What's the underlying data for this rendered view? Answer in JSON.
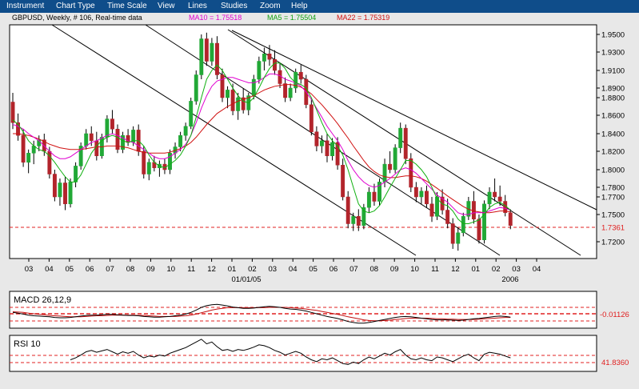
{
  "menu": {
    "items": [
      "Instrument",
      "Chart Type",
      "Time Scale",
      "View",
      "Lines",
      "Studies",
      "Zoom",
      "Help"
    ]
  },
  "colors": {
    "menu_bg": "#0f4d8a",
    "panel_bg": "#ffffff",
    "frame_bg": "#e8e8e8",
    "up_candle": "#21a836",
    "down_candle": "#b2242b",
    "ma10": "#e000d0",
    "ma5": "#10b010",
    "ma22": "#d01010",
    "ref_line": "#e02020"
  },
  "header": {
    "symbol": "GBPUSD",
    "period": "Weekly",
    "count": "# 106",
    "feed": "Real-time data",
    "ma10_label": "MA10 = 1.75518",
    "ma5_label": "MA5 = 1.75504",
    "ma22_label": "MA22 = 1.75319"
  },
  "chart_data": [
    {
      "type": "candlestick",
      "price_levels": [
        1.95,
        1.93,
        1.91,
        1.89,
        1.88,
        1.86,
        1.84,
        1.82,
        1.8,
        1.78,
        1.77,
        1.75,
        1.72
      ],
      "last_price_label": "1.7361",
      "last_price": 1.7361,
      "x_ticks": [
        "03",
        "04",
        "05",
        "06",
        "07",
        "08",
        "09",
        "10",
        "11",
        "12",
        "01",
        "02",
        "03",
        "04",
        "05",
        "06",
        "07",
        "08",
        "09",
        "10",
        "11",
        "12",
        "01",
        "02",
        "03",
        "04"
      ],
      "x_sublabels": [
        "01/01/05",
        "2006"
      ],
      "candles": [
        [
          1.875,
          1.885,
          1.845,
          1.852
        ],
        [
          1.852,
          1.862,
          1.832,
          1.838
        ],
        [
          1.838,
          1.845,
          1.803,
          1.808
        ],
        [
          1.808,
          1.822,
          1.796,
          1.818
        ],
        [
          1.818,
          1.832,
          1.806,
          1.826
        ],
        [
          1.826,
          1.838,
          1.82,
          1.833
        ],
        [
          1.833,
          1.84,
          1.815,
          1.82
        ],
        [
          1.82,
          1.825,
          1.79,
          1.795
        ],
        [
          1.795,
          1.8,
          1.765,
          1.77
        ],
        [
          1.77,
          1.79,
          1.76,
          1.785
        ],
        [
          1.785,
          1.792,
          1.755,
          1.762
        ],
        [
          1.762,
          1.79,
          1.758,
          1.786
        ],
        [
          1.786,
          1.808,
          1.78,
          1.804
        ],
        [
          1.804,
          1.83,
          1.8,
          1.826
        ],
        [
          1.826,
          1.845,
          1.822,
          1.84
        ],
        [
          1.84,
          1.848,
          1.826,
          1.832
        ],
        [
          1.832,
          1.842,
          1.81,
          1.815
        ],
        [
          1.815,
          1.84,
          1.812,
          1.836
        ],
        [
          1.836,
          1.86,
          1.83,
          1.856
        ],
        [
          1.856,
          1.866,
          1.84,
          1.845
        ],
        [
          1.845,
          1.85,
          1.818,
          1.822
        ],
        [
          1.822,
          1.842,
          1.818,
          1.838
        ],
        [
          1.838,
          1.845,
          1.826,
          1.83
        ],
        [
          1.83,
          1.848,
          1.826,
          1.844
        ],
        [
          1.844,
          1.85,
          1.815,
          1.82
        ],
        [
          1.82,
          1.826,
          1.79,
          1.795
        ],
        [
          1.795,
          1.812,
          1.788,
          1.808
        ],
        [
          1.808,
          1.815,
          1.798,
          1.802
        ],
        [
          1.802,
          1.81,
          1.792,
          1.806
        ],
        [
          1.806,
          1.812,
          1.795,
          1.8
        ],
        [
          1.8,
          1.822,
          1.795,
          1.818
        ],
        [
          1.818,
          1.83,
          1.812,
          1.825
        ],
        [
          1.825,
          1.842,
          1.82,
          1.838
        ],
        [
          1.838,
          1.852,
          1.832,
          1.848
        ],
        [
          1.848,
          1.88,
          1.845,
          1.876
        ],
        [
          1.876,
          1.91,
          1.872,
          1.905
        ],
        [
          1.905,
          1.95,
          1.9,
          1.945
        ],
        [
          1.945,
          1.952,
          1.915,
          1.92
        ],
        [
          1.92,
          1.946,
          1.915,
          1.94
        ],
        [
          1.94,
          1.948,
          1.9,
          1.905
        ],
        [
          1.905,
          1.912,
          1.875,
          1.88
        ],
        [
          1.88,
          1.892,
          1.868,
          1.888
        ],
        [
          1.888,
          1.895,
          1.86,
          1.865
        ],
        [
          1.865,
          1.885,
          1.855,
          1.88
        ],
        [
          1.88,
          1.89,
          1.862,
          1.866
        ],
        [
          1.866,
          1.885,
          1.86,
          1.882
        ],
        [
          1.882,
          1.905,
          1.878,
          1.9
        ],
        [
          1.9,
          1.925,
          1.895,
          1.92
        ],
        [
          1.92,
          1.935,
          1.91,
          1.928
        ],
        [
          1.928,
          1.938,
          1.915,
          1.922
        ],
        [
          1.922,
          1.932,
          1.905,
          1.91
        ],
        [
          1.91,
          1.918,
          1.89,
          1.895
        ],
        [
          1.895,
          1.902,
          1.875,
          1.88
        ],
        [
          1.88,
          1.895,
          1.876,
          1.89
        ],
        [
          1.89,
          1.912,
          1.885,
          1.908
        ],
        [
          1.908,
          1.916,
          1.895,
          1.9
        ],
        [
          1.9,
          1.905,
          1.868,
          1.872
        ],
        [
          1.872,
          1.878,
          1.838,
          1.842
        ],
        [
          1.842,
          1.848,
          1.82,
          1.826
        ],
        [
          1.826,
          1.838,
          1.818,
          1.832
        ],
        [
          1.832,
          1.84,
          1.808,
          1.815
        ],
        [
          1.815,
          1.835,
          1.81,
          1.83
        ],
        [
          1.83,
          1.836,
          1.8,
          1.805
        ],
        [
          1.805,
          1.812,
          1.766,
          1.77
        ],
        [
          1.77,
          1.776,
          1.735,
          1.74
        ],
        [
          1.74,
          1.752,
          1.732,
          1.748
        ],
        [
          1.748,
          1.756,
          1.732,
          1.738
        ],
        [
          1.738,
          1.762,
          1.734,
          1.758
        ],
        [
          1.758,
          1.78,
          1.752,
          1.775
        ],
        [
          1.775,
          1.784,
          1.76,
          1.765
        ],
        [
          1.765,
          1.79,
          1.76,
          1.786
        ],
        [
          1.786,
          1.812,
          1.78,
          1.806
        ],
        [
          1.806,
          1.82,
          1.796,
          1.8
        ],
        [
          1.8,
          1.828,
          1.796,
          1.824
        ],
        [
          1.824,
          1.852,
          1.818,
          1.846
        ],
        [
          1.846,
          1.85,
          1.806,
          1.812
        ],
        [
          1.812,
          1.818,
          1.775,
          1.78
        ],
        [
          1.78,
          1.786,
          1.764,
          1.77
        ],
        [
          1.77,
          1.78,
          1.762,
          1.776
        ],
        [
          1.776,
          1.782,
          1.758,
          1.762
        ],
        [
          1.762,
          1.77,
          1.742,
          1.748
        ],
        [
          1.748,
          1.775,
          1.744,
          1.77
        ],
        [
          1.77,
          1.778,
          1.75,
          1.755
        ],
        [
          1.755,
          1.768,
          1.735,
          1.74
        ],
        [
          1.74,
          1.746,
          1.712,
          1.718
        ],
        [
          1.718,
          1.736,
          1.71,
          1.73
        ],
        [
          1.73,
          1.752,
          1.726,
          1.748
        ],
        [
          1.748,
          1.77,
          1.744,
          1.765
        ],
        [
          1.765,
          1.776,
          1.74,
          1.745
        ],
        [
          1.745,
          1.75,
          1.718,
          1.722
        ],
        [
          1.722,
          1.766,
          1.718,
          1.762
        ],
        [
          1.762,
          1.78,
          1.756,
          1.775
        ],
        [
          1.775,
          1.79,
          1.765,
          1.77
        ],
        [
          1.77,
          1.782,
          1.76,
          1.765
        ],
        [
          1.765,
          1.772,
          1.748,
          1.752
        ],
        [
          1.752,
          1.756,
          1.734,
          1.738
        ]
      ],
      "ma10": [
        1.85,
        1.848,
        1.845,
        1.84,
        1.836,
        1.832,
        1.826,
        1.82,
        1.815,
        1.812,
        1.812,
        1.814,
        1.818,
        1.822,
        1.826,
        1.83,
        1.832,
        1.835,
        1.838,
        1.84,
        1.838,
        1.835,
        1.832,
        1.83,
        1.826,
        1.822,
        1.818,
        1.814,
        1.812,
        1.812,
        1.814,
        1.818,
        1.822,
        1.828,
        1.838,
        1.852,
        1.868,
        1.882,
        1.892,
        1.898,
        1.9,
        1.902,
        1.902,
        1.9,
        1.898,
        1.896,
        1.896,
        1.898,
        1.902,
        1.906,
        1.906,
        1.904,
        1.9,
        1.898,
        1.896,
        1.892,
        1.886,
        1.878,
        1.868,
        1.858,
        1.848,
        1.84,
        1.832,
        1.822,
        1.81,
        1.8,
        1.792,
        1.786,
        1.782,
        1.78,
        1.782,
        1.786,
        1.79,
        1.795,
        1.8,
        1.802,
        1.8,
        1.796,
        1.79,
        1.784,
        1.778,
        1.772,
        1.768,
        1.764,
        1.758,
        1.752,
        1.75,
        1.75,
        1.752,
        1.752,
        1.752,
        1.754,
        1.756,
        1.758,
        1.757,
        1.755
      ],
      "ma5": [
        1.855,
        1.85,
        1.842,
        1.832,
        1.826,
        1.822,
        1.82,
        1.815,
        1.808,
        1.8,
        1.792,
        1.786,
        1.786,
        1.794,
        1.806,
        1.818,
        1.826,
        1.832,
        1.836,
        1.838,
        1.836,
        1.832,
        1.83,
        1.832,
        1.832,
        1.826,
        1.816,
        1.808,
        1.804,
        1.802,
        1.806,
        1.81,
        1.816,
        1.826,
        1.838,
        1.858,
        1.88,
        1.9,
        1.91,
        1.916,
        1.91,
        1.9,
        1.89,
        1.882,
        1.876,
        1.874,
        1.88,
        1.89,
        1.902,
        1.912,
        1.918,
        1.918,
        1.912,
        1.902,
        1.896,
        1.894,
        1.89,
        1.88,
        1.866,
        1.852,
        1.84,
        1.832,
        1.826,
        1.816,
        1.8,
        1.78,
        1.762,
        1.754,
        1.752,
        1.754,
        1.76,
        1.77,
        1.78,
        1.79,
        1.8,
        1.81,
        1.81,
        1.806,
        1.8,
        1.792,
        1.78,
        1.768,
        1.762,
        1.76,
        1.754,
        1.745,
        1.74,
        1.74,
        1.742,
        1.744,
        1.75,
        1.758,
        1.762,
        1.764,
        1.76,
        1.755
      ],
      "ma22": [
        1.84,
        1.84,
        1.839,
        1.838,
        1.836,
        1.834,
        1.831,
        1.828,
        1.826,
        1.824,
        1.823,
        1.822,
        1.822,
        1.822,
        1.823,
        1.824,
        1.825,
        1.825,
        1.826,
        1.826,
        1.826,
        1.825,
        1.824,
        1.822,
        1.82,
        1.819,
        1.818,
        1.818,
        1.818,
        1.818,
        1.819,
        1.821,
        1.823,
        1.826,
        1.83,
        1.836,
        1.843,
        1.85,
        1.856,
        1.862,
        1.866,
        1.87,
        1.873,
        1.876,
        1.878,
        1.88,
        1.882,
        1.885,
        1.888,
        1.89,
        1.892,
        1.893,
        1.894,
        1.894,
        1.893,
        1.891,
        1.888,
        1.884,
        1.878,
        1.872,
        1.865,
        1.858,
        1.851,
        1.843,
        1.835,
        1.826,
        1.818,
        1.81,
        1.803,
        1.798,
        1.794,
        1.792,
        1.791,
        1.791,
        1.792,
        1.793,
        1.793,
        1.792,
        1.79,
        1.787,
        1.783,
        1.779,
        1.775,
        1.771,
        1.767,
        1.763,
        1.759,
        1.756,
        1.754,
        1.753,
        1.752,
        1.752,
        1.753,
        1.754,
        1.754,
        1.753
      ]
    },
    {
      "type": "line",
      "title": "MACD 26,12,9",
      "value_label": "-0.01126",
      "macd": [
        0.004,
        0.002,
        -0.001,
        -0.004,
        -0.006,
        -0.007,
        -0.008,
        -0.009,
        -0.011,
        -0.012,
        -0.012,
        -0.011,
        -0.009,
        -0.007,
        -0.005,
        -0.004,
        -0.004,
        -0.003,
        -0.002,
        -0.002,
        -0.003,
        -0.004,
        -0.005,
        -0.005,
        -0.006,
        -0.008,
        -0.009,
        -0.01,
        -0.01,
        -0.009,
        -0.008,
        -0.006,
        -0.004,
        -0.001,
        0.004,
        0.011,
        0.019,
        0.024,
        0.027,
        0.028,
        0.026,
        0.023,
        0.02,
        0.018,
        0.016,
        0.016,
        0.017,
        0.019,
        0.021,
        0.022,
        0.021,
        0.019,
        0.016,
        0.014,
        0.013,
        0.011,
        0.008,
        0.004,
        0.0,
        -0.004,
        -0.008,
        -0.011,
        -0.014,
        -0.018,
        -0.023,
        -0.026,
        -0.028,
        -0.028,
        -0.026,
        -0.023,
        -0.02,
        -0.017,
        -0.014,
        -0.011,
        -0.009,
        -0.008,
        -0.009,
        -0.011,
        -0.013,
        -0.015,
        -0.017,
        -0.018,
        -0.018,
        -0.018,
        -0.019,
        -0.02,
        -0.019,
        -0.017,
        -0.015,
        -0.014,
        -0.012,
        -0.01,
        -0.008,
        -0.007,
        -0.008,
        -0.01
      ],
      "signal": [
        0.006,
        0.005,
        0.004,
        0.002,
        0.0,
        -0.002,
        -0.003,
        -0.005,
        -0.006,
        -0.007,
        -0.008,
        -0.009,
        -0.009,
        -0.009,
        -0.008,
        -0.007,
        -0.006,
        -0.006,
        -0.005,
        -0.004,
        -0.004,
        -0.004,
        -0.004,
        -0.004,
        -0.005,
        -0.005,
        -0.006,
        -0.007,
        -0.008,
        -0.008,
        -0.008,
        -0.008,
        -0.007,
        -0.006,
        -0.004,
        -0.001,
        0.003,
        0.007,
        0.011,
        0.014,
        0.016,
        0.018,
        0.018,
        0.018,
        0.018,
        0.018,
        0.018,
        0.018,
        0.018,
        0.019,
        0.019,
        0.019,
        0.019,
        0.018,
        0.017,
        0.016,
        0.014,
        0.012,
        0.01,
        0.007,
        0.004,
        0.001,
        -0.002,
        -0.005,
        -0.009,
        -0.012,
        -0.015,
        -0.018,
        -0.02,
        -0.021,
        -0.021,
        -0.02,
        -0.019,
        -0.017,
        -0.016,
        -0.014,
        -0.013,
        -0.013,
        -0.013,
        -0.013,
        -0.014,
        -0.015,
        -0.015,
        -0.016,
        -0.016,
        -0.017,
        -0.017,
        -0.017,
        -0.017,
        -0.016,
        -0.015,
        -0.014,
        -0.013,
        -0.012,
        -0.011,
        -0.011
      ]
    },
    {
      "type": "line",
      "title": "RSI 10",
      "value_label": "41.8360",
      "rsi": [
        null,
        null,
        null,
        null,
        null,
        null,
        null,
        null,
        null,
        null,
        null,
        38,
        42,
        48,
        55,
        58,
        54,
        57,
        60,
        55,
        50,
        55,
        52,
        56,
        48,
        42,
        46,
        44,
        48,
        46,
        52,
        56,
        60,
        64,
        70,
        76,
        82,
        72,
        76,
        66,
        58,
        60,
        56,
        60,
        58,
        61,
        65,
        70,
        68,
        64,
        58,
        54,
        48,
        52,
        56,
        52,
        44,
        38,
        34,
        40,
        38,
        42,
        36,
        30,
        28,
        33,
        30,
        38,
        44,
        40,
        46,
        52,
        48,
        55,
        60,
        48,
        40,
        38,
        42,
        38,
        36,
        44,
        42,
        38,
        34,
        40,
        46,
        50,
        42,
        36,
        50,
        54,
        52,
        50,
        46,
        42
      ]
    }
  ]
}
